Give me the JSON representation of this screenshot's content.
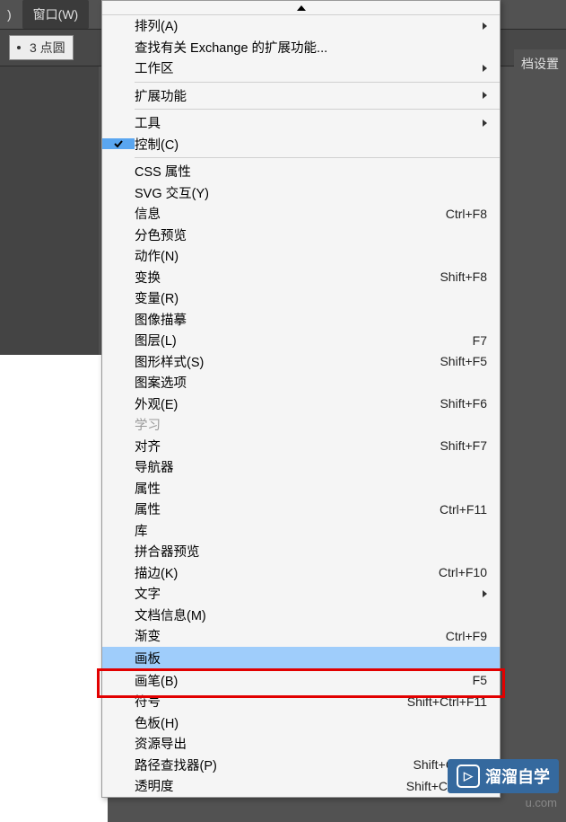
{
  "menubar": {
    "left_fragment": ")",
    "window_label": "窗口(W)"
  },
  "toolbar": {
    "point_circle": "3  点圆"
  },
  "doc_settings": "档设置",
  "menu": {
    "arrange": "排列(A)",
    "exchange": "查找有关 Exchange 的扩展功能...",
    "workspace": "工作区",
    "extensions": "扩展功能",
    "tools": "工具",
    "control": "控制(C)",
    "css_props": "CSS 属性",
    "svg_interact": "SVG 交互(Y)",
    "info": "信息",
    "info_sc": "Ctrl+F8",
    "sep_preview": "分色预览",
    "actions": "动作(N)",
    "transform": "变换",
    "transform_sc": "Shift+F8",
    "variables": "变量(R)",
    "image_trace": "图像描摹",
    "layers": "图层(L)",
    "layers_sc": "F7",
    "graphic_styles": "图形样式(S)",
    "graphic_styles_sc": "Shift+F5",
    "pattern_options": "图案选项",
    "appearance": "外观(E)",
    "appearance_sc": "Shift+F6",
    "learn": "学习",
    "align": "对齐",
    "align_sc": "Shift+F7",
    "navigator": "导航器",
    "attributes": "属性",
    "properties": "属性",
    "properties_sc": "Ctrl+F11",
    "library": "库",
    "flattener": "拼合器预览",
    "stroke": "描边(K)",
    "stroke_sc": "Ctrl+F10",
    "type": "文字",
    "doc_info": "文档信息(M)",
    "gradient": "渐变",
    "gradient_sc": "Ctrl+F9",
    "artboards": "画板",
    "brushes": "画笔(B)",
    "brushes_sc": "F5",
    "symbols": "符号",
    "symbols_sc": "Shift+Ctrl+F11",
    "swatches": "色板(H)",
    "asset_export": "资源导出",
    "pathfinder": "路径查找器(P)",
    "pathfinder_sc": "Shift+Ctrl+F9",
    "transparency": "透明度",
    "transparency_sc": "Shift+Ctrl+F10"
  },
  "watermark": {
    "text": "溜溜自学",
    "sub": "u.com"
  }
}
